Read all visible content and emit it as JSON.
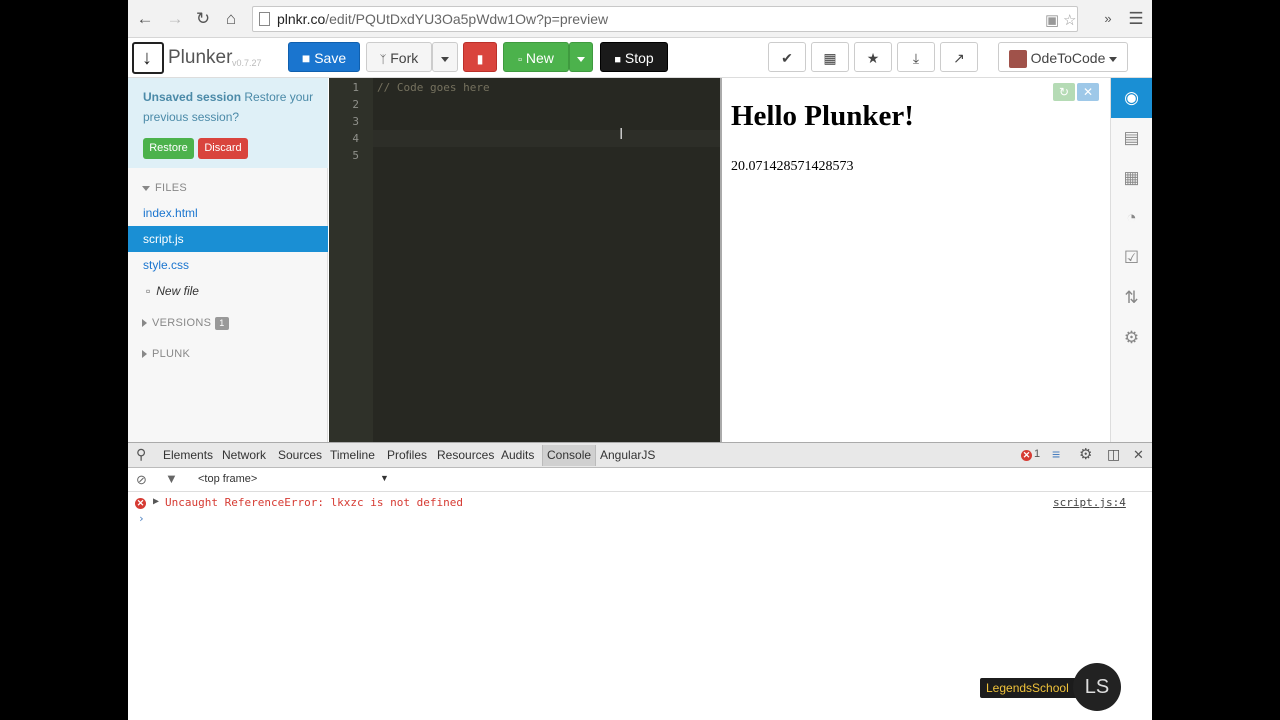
{
  "browser": {
    "url_host": "plnkr.co",
    "url_path": "/edit/PQUtDxdYU3Oa5pWdw1Ow?p=preview",
    "icons": [
      "back-icon",
      "forward-icon",
      "reload-icon",
      "home-icon",
      "reader-icon",
      "star-icon",
      "extensions-icon",
      "menu-icon"
    ]
  },
  "toolbar": {
    "brand": "Plunker",
    "version": "v0.7.27",
    "save_label": "Save",
    "fork_label": "Fork",
    "new_label": "New",
    "stop_label": "Stop",
    "user_label": "OdeToCode"
  },
  "sidebar": {
    "session_title": "Unsaved session",
    "session_text": "Restore your previous session?",
    "restore_label": "Restore",
    "discard_label": "Discard",
    "files_header": "FILES",
    "files": [
      {
        "name": "index.html",
        "active": false
      },
      {
        "name": "script.js",
        "active": true
      },
      {
        "name": "style.css",
        "active": false
      }
    ],
    "new_file_label": "New file",
    "versions_header": "VERSIONS",
    "versions_count": "1",
    "plunk_header": "PLUNK"
  },
  "editor": {
    "line_numbers": [
      "1",
      "2",
      "3",
      "4",
      "5"
    ],
    "lines": [
      "// Code goes here",
      "",
      "",
      "",
      ""
    ]
  },
  "preview": {
    "heading": "Hello Plunker!",
    "value": "20.071428571428573"
  },
  "devtools": {
    "tabs": [
      "Elements",
      "Network",
      "Sources",
      "Timeline",
      "Profiles",
      "Resources",
      "Audits",
      "Console",
      "AngularJS"
    ],
    "selected_tab": "Console",
    "error_count": "1",
    "frame_select": "<top frame>",
    "error_message": "Uncaught ReferenceError: lkxzc is not defined",
    "error_source": "script.js:4",
    "prompt": "›"
  },
  "watermark": {
    "label": "LegendsSchool",
    "initials": "LS"
  },
  "colors": {
    "accent_blue": "#1a75cf",
    "editor_bg": "#272822",
    "error_red": "#d63b33",
    "session_bg": "#dff0f7"
  }
}
